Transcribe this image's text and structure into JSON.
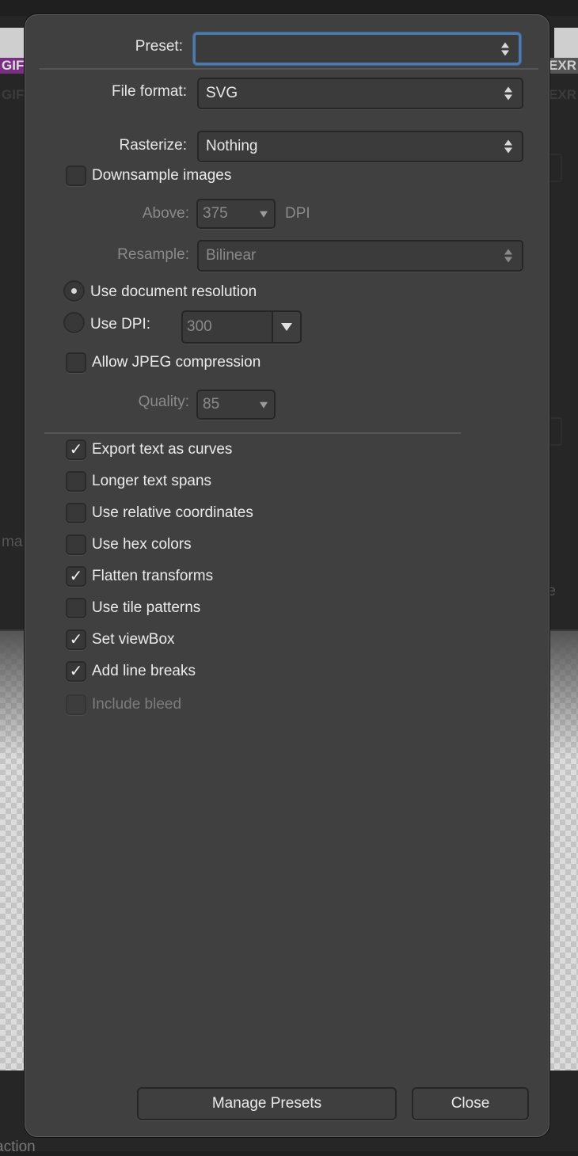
{
  "background": {
    "left_tag": "GIF",
    "right_tag": "EXR",
    "left_ghost_tag": "GIF",
    "right_ghost_tag": "EXR",
    "left_partial_text": "ma",
    "right_partial_text": "e",
    "bottom_partial_text": "action"
  },
  "dialog": {
    "preset": {
      "label": "Preset:",
      "value": ""
    },
    "file_format": {
      "label": "File format:",
      "value": "SVG"
    },
    "rasterize": {
      "label": "Rasterize:",
      "value": "Nothing"
    },
    "downsample": {
      "label": "Downsample images",
      "checked": false
    },
    "above": {
      "label": "Above:",
      "value": "375",
      "unit": "DPI"
    },
    "resample": {
      "label": "Resample:",
      "value": "Bilinear"
    },
    "resolution": {
      "use_document": {
        "label": "Use document resolution",
        "selected": true
      },
      "use_dpi": {
        "label": "Use DPI:",
        "selected": false,
        "value": "300"
      }
    },
    "jpeg": {
      "label": "Allow JPEG compression",
      "checked": false
    },
    "quality": {
      "label": "Quality:",
      "value": "85"
    },
    "options": [
      {
        "label": "Export text as curves",
        "checked": true,
        "mark": "✓",
        "enabled": true
      },
      {
        "label": "Longer text spans",
        "checked": false,
        "mark": "",
        "enabled": true
      },
      {
        "label": "Use relative coordinates",
        "checked": false,
        "mark": "",
        "enabled": true
      },
      {
        "label": "Use hex colors",
        "checked": false,
        "mark": "",
        "enabled": true
      },
      {
        "label": "Flatten transforms",
        "checked": true,
        "mark": "✓",
        "enabled": true
      },
      {
        "label": "Use tile patterns",
        "checked": false,
        "mark": "",
        "enabled": true
      },
      {
        "label": "Set viewBox",
        "checked": true,
        "mark": "✓",
        "enabled": true
      },
      {
        "label": "Add line breaks",
        "checked": true,
        "mark": "✓",
        "enabled": true
      },
      {
        "label": "Include bleed",
        "checked": false,
        "mark": "",
        "enabled": false
      }
    ],
    "buttons": {
      "manage_presets": "Manage Presets",
      "close": "Close"
    }
  },
  "colors": {
    "dialog_bg": "#404040",
    "focus_ring": "#4c7bb0",
    "gif_tag": "#7a2f82"
  }
}
